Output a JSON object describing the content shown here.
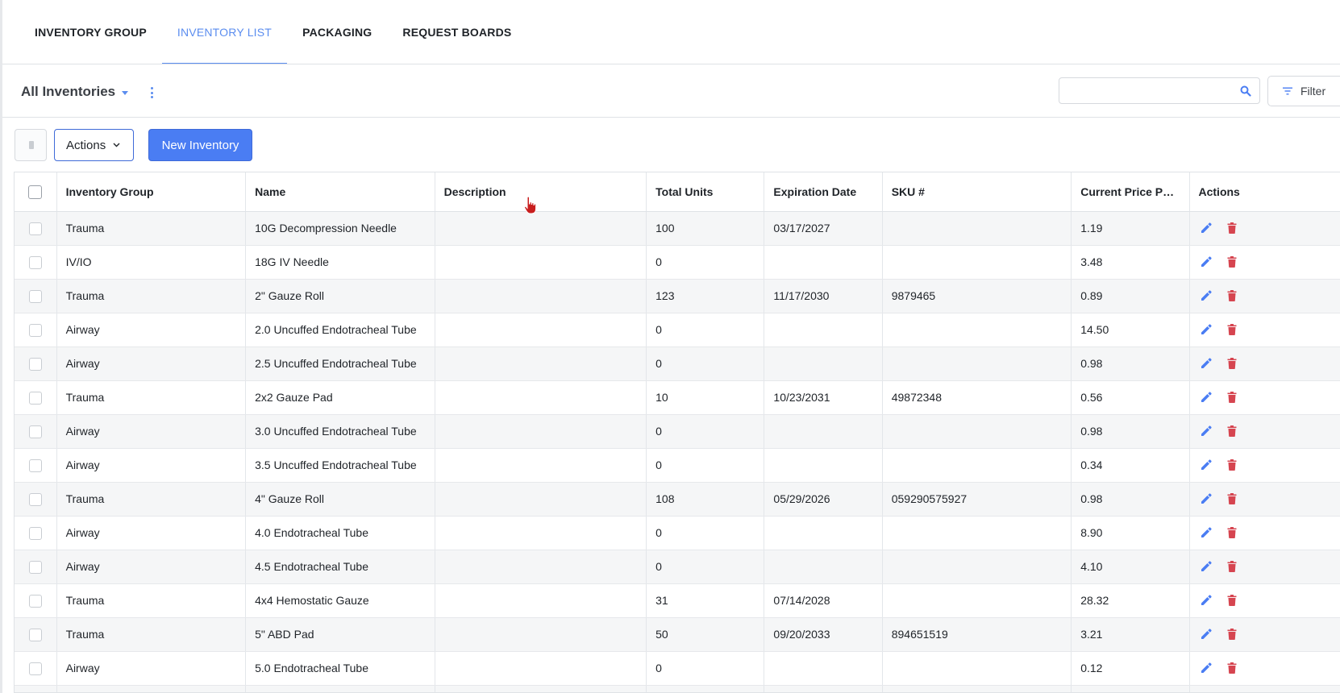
{
  "tabs": [
    {
      "label": "INVENTORY GROUP"
    },
    {
      "label": "INVENTORY LIST"
    },
    {
      "label": "PACKAGING"
    },
    {
      "label": "REQUEST BOARDS"
    }
  ],
  "active_tab": "INVENTORY LIST",
  "toolbar": {
    "inventory_selector": "All Inventories",
    "search_placeholder": "",
    "filter_label": "Filter"
  },
  "action_bar": {
    "actions_label": "Actions",
    "new_inventory_label": "New Inventory"
  },
  "table": {
    "columns": [
      "Inventory Group",
      "Name",
      "Description",
      "Total Units",
      "Expiration Date",
      "SKU #",
      "Current Price Per ...",
      "Actions"
    ],
    "rows": [
      {
        "group": "Trauma",
        "name": "10G Decompression Needle",
        "description": "",
        "units": "100",
        "expiration": "03/17/2027",
        "sku": "",
        "price": "1.19"
      },
      {
        "group": "IV/IO",
        "name": "18G IV Needle",
        "description": "",
        "units": "0",
        "expiration": "",
        "sku": "",
        "price": "3.48"
      },
      {
        "group": "Trauma",
        "name": "2\" Gauze Roll",
        "description": "",
        "units": "123",
        "expiration": "11/17/2030",
        "sku": "9879465",
        "price": "0.89"
      },
      {
        "group": "Airway",
        "name": "2.0 Uncuffed Endotracheal Tube",
        "description": "",
        "units": "0",
        "expiration": "",
        "sku": "",
        "price": "14.50"
      },
      {
        "group": "Airway",
        "name": "2.5 Uncuffed Endotracheal Tube",
        "description": "",
        "units": "0",
        "expiration": "",
        "sku": "",
        "price": "0.98"
      },
      {
        "group": "Trauma",
        "name": "2x2 Gauze Pad",
        "description": "",
        "units": "10",
        "expiration": "10/23/2031",
        "sku": "49872348",
        "price": "0.56"
      },
      {
        "group": "Airway",
        "name": "3.0 Uncuffed Endotracheal Tube",
        "description": "",
        "units": "0",
        "expiration": "",
        "sku": "",
        "price": "0.98"
      },
      {
        "group": "Airway",
        "name": "3.5 Uncuffed Endotracheal Tube",
        "description": "",
        "units": "0",
        "expiration": "",
        "sku": "",
        "price": "0.34"
      },
      {
        "group": "Trauma",
        "name": "4\" Gauze Roll",
        "description": "",
        "units": "108",
        "expiration": "05/29/2026",
        "sku": "059290575927",
        "price": "0.98"
      },
      {
        "group": "Airway",
        "name": "4.0 Endotracheal Tube",
        "description": "",
        "units": "0",
        "expiration": "",
        "sku": "",
        "price": "8.90"
      },
      {
        "group": "Airway",
        "name": "4.5 Endotracheal Tube",
        "description": "",
        "units": "0",
        "expiration": "",
        "sku": "",
        "price": "4.10"
      },
      {
        "group": "Trauma",
        "name": "4x4 Hemostatic Gauze",
        "description": "",
        "units": "31",
        "expiration": "07/14/2028",
        "sku": "",
        "price": "28.32"
      },
      {
        "group": "Trauma",
        "name": "5\" ABD Pad",
        "description": "",
        "units": "50",
        "expiration": "09/20/2033",
        "sku": "894651519",
        "price": "3.21"
      },
      {
        "group": "Airway",
        "name": "5.0 Endotracheal Tube",
        "description": "",
        "units": "0",
        "expiration": "",
        "sku": "",
        "price": "0.12"
      },
      {
        "group": "",
        "name": "",
        "description": "",
        "units": "",
        "expiration": "",
        "sku": "",
        "price": ""
      }
    ]
  },
  "icons": {
    "edit": "pencil-icon",
    "delete": "trash-icon",
    "search": "search-icon",
    "filter": "filter-icon",
    "more": "kebab-icon"
  },
  "colors": {
    "accent": "#4a7df3",
    "tab_active": "#5b8def",
    "edit_icon": "#4a7df3",
    "delete_icon": "#d64550",
    "stripe": "#f5f6f7"
  }
}
